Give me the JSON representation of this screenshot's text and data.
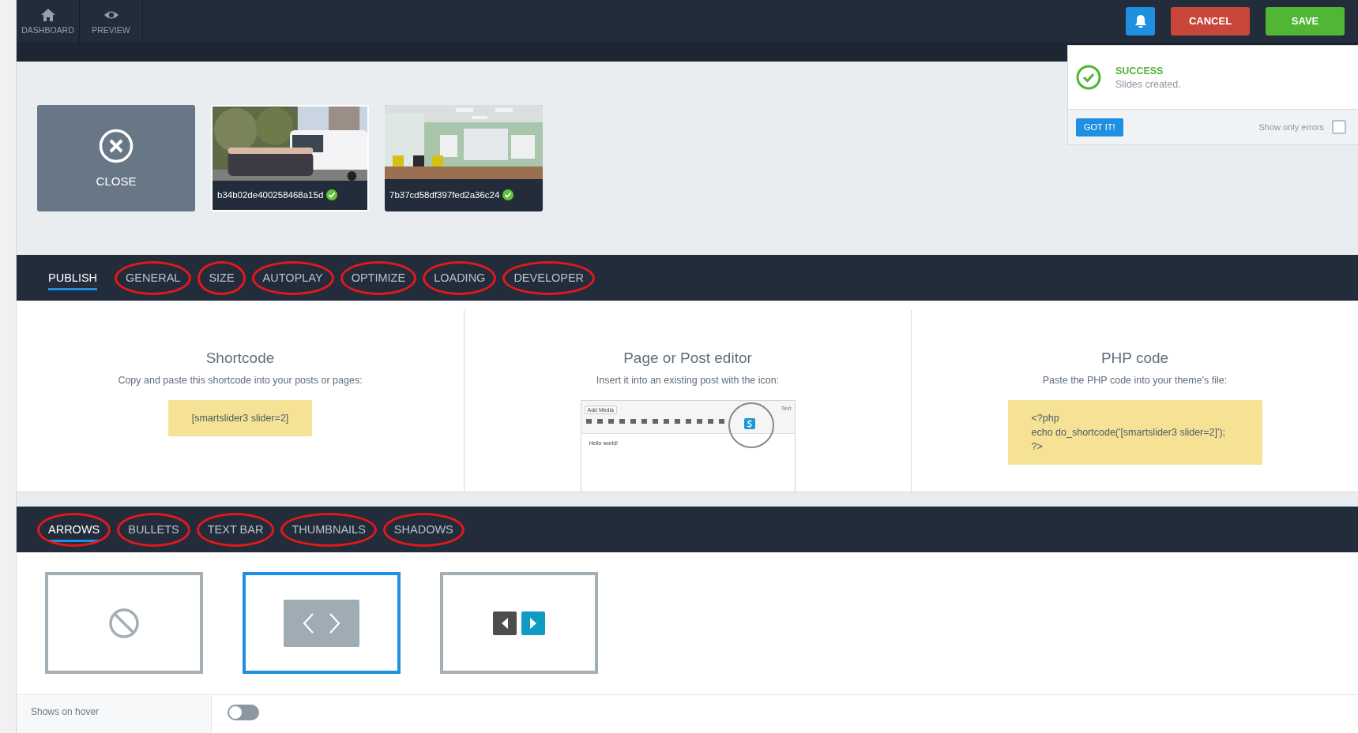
{
  "nav": [
    {
      "label": "DASHBOARD"
    },
    {
      "label": "PREVIEW"
    }
  ],
  "actions": {
    "cancel": "CANCEL",
    "save": "SAVE"
  },
  "notification": {
    "title": "SUCCESS",
    "message": "Slides created.",
    "button": "GOT IT!",
    "checkbox_label": "Show only errors",
    "checked": false
  },
  "slides": {
    "close": "CLOSE",
    "items": [
      {
        "name": "b34b02de400258468a15d",
        "ok": true
      },
      {
        "name": "7b37cd58df397fed2a36c24",
        "ok": true
      }
    ]
  },
  "tabs": [
    {
      "label": "PUBLISH",
      "selected": true,
      "circled": false
    },
    {
      "label": "GENERAL",
      "selected": false,
      "circled": true
    },
    {
      "label": "SIZE",
      "selected": false,
      "circled": true
    },
    {
      "label": "AUTOPLAY",
      "selected": false,
      "circled": true
    },
    {
      "label": "OPTIMIZE",
      "selected": false,
      "circled": true
    },
    {
      "label": "LOADING",
      "selected": false,
      "circled": true
    },
    {
      "label": "DEVELOPER",
      "selected": false,
      "circled": true
    }
  ],
  "publish": [
    {
      "kind": "code",
      "title": "Shortcode",
      "description": "Copy and paste this shortcode into your posts or pages:",
      "code": [
        "[smartslider3 slider=2]"
      ]
    },
    {
      "kind": "editor",
      "title": "Page or Post editor",
      "description": "Insert it into an existing post with the icon:",
      "add_media": "Add Media",
      "mode": "Text",
      "content": "Hello world!"
    },
    {
      "kind": "code",
      "title": "PHP code",
      "description": "Paste the PHP code into your theme's file:",
      "code": [
        "<?php",
        "echo do_shortcode('[smartslider3 slider=2]');",
        "?>"
      ]
    }
  ],
  "widget_tabs": [
    {
      "label": "ARROWS",
      "selected": true,
      "circled": true
    },
    {
      "label": "BULLETS",
      "selected": false,
      "circled": true
    },
    {
      "label": "TEXT BAR",
      "selected": false,
      "circled": true
    },
    {
      "label": "THUMBNAILS",
      "selected": false,
      "circled": true
    },
    {
      "label": "SHADOWS",
      "selected": false,
      "circled": true
    }
  ],
  "arrow_styles": [
    {
      "kind": "none",
      "selected": false
    },
    {
      "kind": "chevrons",
      "selected": true
    },
    {
      "kind": "buttons",
      "selected": false
    }
  ],
  "settings": [
    {
      "label": "Shows on hover",
      "on": false
    }
  ]
}
